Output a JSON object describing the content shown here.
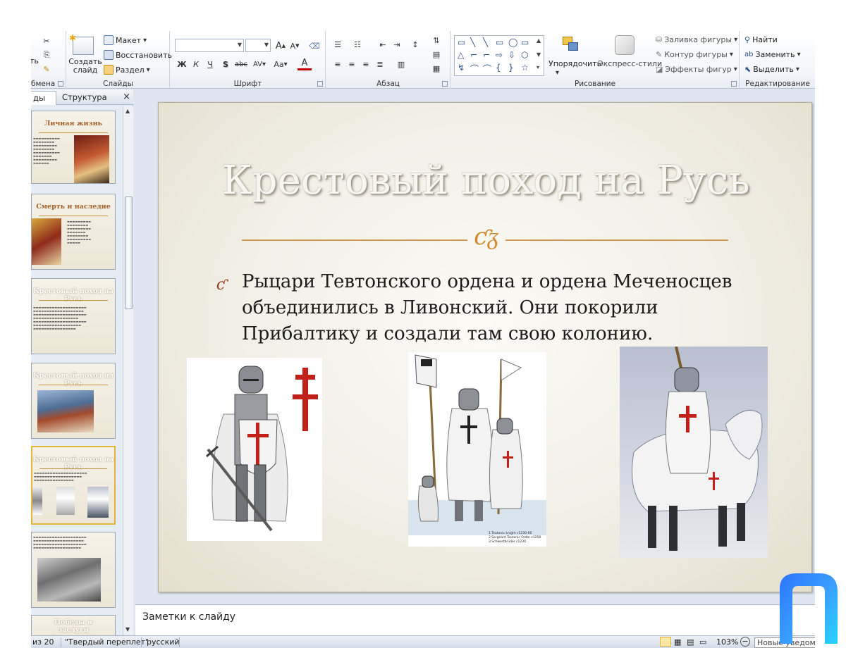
{
  "ribbon": {
    "clipboard": {
      "paste_partial": "ть",
      "group_label": "бмена"
    },
    "slides": {
      "new_slide": "Создать слайд",
      "layout": "Макет",
      "reset": "Восстановить",
      "section": "Раздел",
      "group_label": "Слайды"
    },
    "font": {
      "group_label": "Шрифт",
      "grow": "A",
      "shrink": "A",
      "bold": "Ж",
      "italic": "К",
      "underline": "Ч",
      "shadow": "S",
      "strike": "abc",
      "spacing": "AV",
      "case": "Aa",
      "color": "A"
    },
    "paragraph": {
      "group_label": "Абзац"
    },
    "drawing": {
      "group_label": "Рисование",
      "arrange": "Упорядочить",
      "quick_styles": "Экспресс-стили",
      "shape_fill": "Заливка фигуры",
      "shape_outline": "Контур фигуры",
      "shape_effects": "Эффекты фигур"
    },
    "editing": {
      "group_label": "Редактирование",
      "find": "Найти",
      "replace": "Заменить",
      "select": "Выделить"
    }
  },
  "left_panel": {
    "tab_slides": "ды",
    "tab_outline": "Структура",
    "close": "×",
    "thumbnails": [
      {
        "title": "Личная жизнь"
      },
      {
        "title": "Смерть и наследие"
      },
      {
        "title": "Крестовый поход на Русь"
      },
      {
        "title": "Крестовый поход на Русь"
      },
      {
        "title": "Крестовый поход на Русь"
      },
      {
        "title": ""
      },
      {
        "title": "Победы и заслуги Александра Невского"
      }
    ]
  },
  "slide": {
    "title": "Крестовый поход на Русь",
    "bullet_mark": "ƈ",
    "ornament": "ƈᵹ",
    "bullet_text": "Рыцари Тевтонского ордена и ордена Меченосцев объединились в Ливонский. Они покорили Прибалтику и создали там свою колонию.",
    "caption_lines": [
      "1 Teutonic knight c1230-60",
      "2 Sergeant Teutonic Order c1250",
      "3 Schwertbrüder c1230"
    ]
  },
  "notes": {
    "placeholder": "Заметки к слайду"
  },
  "status": {
    "slide_count": "из 20",
    "theme": "\"Твердый переплет\"",
    "language": "русский",
    "zoom": "103%",
    "notification": "Новые уведомл"
  },
  "colors": {
    "accent_orange": "#d29a52",
    "bullet_red": "#9b3c26",
    "ribbon_bg": "#f4f6fa"
  }
}
